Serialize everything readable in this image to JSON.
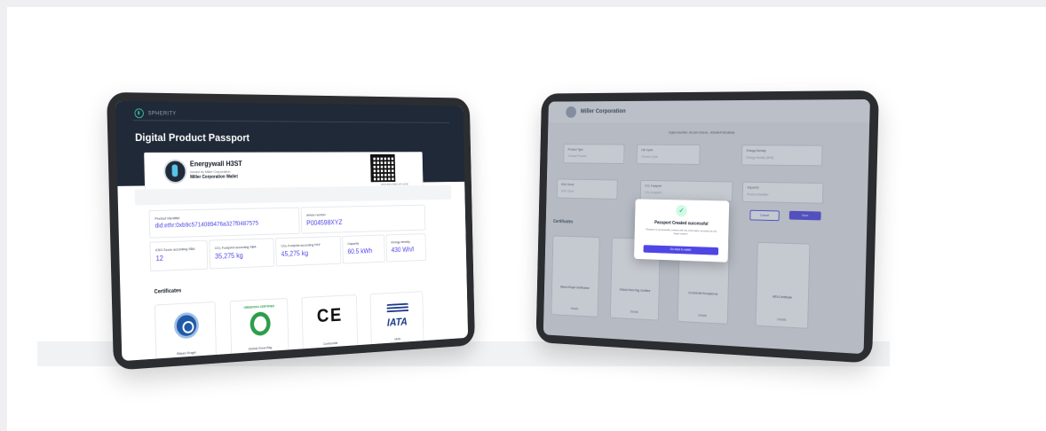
{
  "left_tablet": {
    "brand": "SPHERITY",
    "title": "Digital Product Passport",
    "product": {
      "name": "Energywall H3ST",
      "issued_by": "Issued by Miller Corporation",
      "wallet": "Miller Corporation Wallet",
      "qr_caption": "DATA ENCODED QR CODE"
    },
    "fields": {
      "product_identifier_label": "Product Identifier",
      "product_identifier_value": "did:ethr:0xb9c5714089476a327f0487575",
      "article_number_label": "Article number",
      "article_number_value": "P004598XYZ",
      "esg_label": "ESG Score according SBA",
      "esg_value": "12",
      "co2_sba_label": "CO₂ Footprint according SBA",
      "co2_sba_value": "35,275 kg",
      "co2_pef_label": "CO₂ Footprint according PEF",
      "co2_pef_value": "45,275 kg",
      "capacity_label": "Capacity",
      "capacity_value": "60.5 kWh",
      "energy_density_label": "Energy density",
      "energy_density_value": "430 Wh/l"
    },
    "certificates_title": "Certificates",
    "certificates": [
      {
        "name": "Blauer Engel",
        "icon": "blue-angel-icon"
      },
      {
        "name": "Global GreenTag",
        "icon": "greentag-icon",
        "logo_text": "GREENTAG CERTIFIED"
      },
      {
        "name": "Conformité",
        "icon": "ce-mark-icon",
        "logo_text": "CE"
      },
      {
        "name": "IATA",
        "icon": "iata-icon",
        "logo_text": "IATA"
      }
    ]
  },
  "right_tablet": {
    "company": "Miller Corporation",
    "subtitle": "Digital identifier: did:ethr:0x5e4e...4d5c8b4f 6b2d8c8e",
    "fields": [
      {
        "label": "Product Type",
        "placeholder": "Choose Product"
      },
      {
        "label": "Life Cycle",
        "placeholder": "Choose Cycle"
      },
      {
        "label": "Energy Density",
        "placeholder": "Energy density (Wh/l)"
      },
      {
        "label": "ESG Score",
        "placeholder": "ESG Score"
      },
      {
        "label": "CO₂ Footprint",
        "placeholder": "CO₂ Footprint"
      },
      {
        "label": "Import ID",
        "placeholder": "Product identifier"
      }
    ],
    "cancel_label": "Cancel",
    "save_label": "Save",
    "certificates_title": "Certificates",
    "certificates": [
      {
        "name": "Blauer Engel Certification"
      },
      {
        "name": "Global GreenTag Certified"
      },
      {
        "name": "Conformité Européenne"
      },
      {
        "name": "IATA Certificate"
      }
    ],
    "details_label": "Details",
    "modal": {
      "title": "Passport Created successful",
      "text": "Passport is successfully created with the information provided by the target system.",
      "button": "Go back to wallet"
    }
  }
}
